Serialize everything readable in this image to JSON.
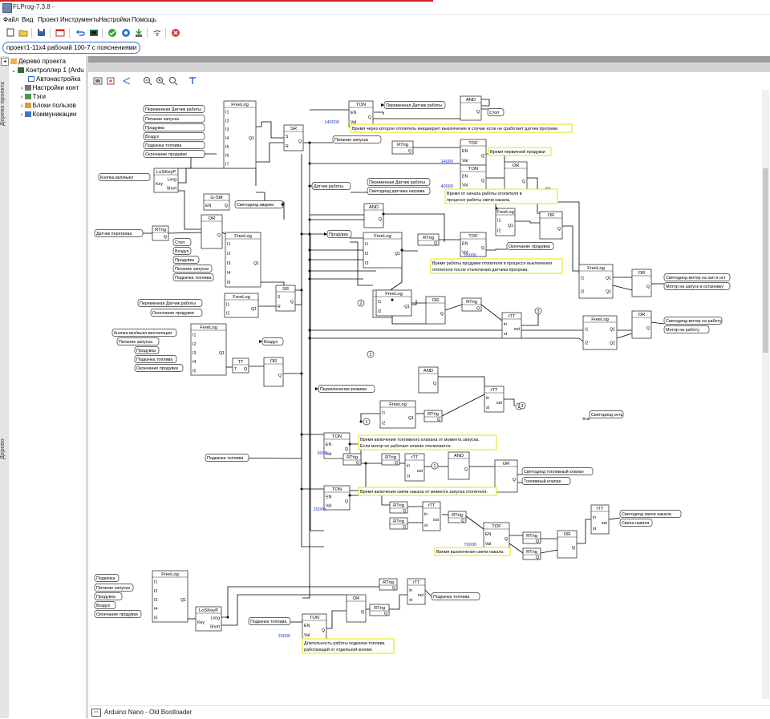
{
  "window": {
    "title": "FLProg-7.3.8 -"
  },
  "menu": {
    "items": [
      "Файл",
      "Вид",
      "Проект",
      "Инструменты",
      "Настройки",
      "Помощь"
    ]
  },
  "project_tab": {
    "label": "проект1-11х4 рабочий 100-7 с пояснениями"
  },
  "side_labels": {
    "project_tree": "Дерево проекта",
    "tree": "Дерево"
  },
  "tree": {
    "root": "Дерево проекта",
    "controller": "Контроллер 1 (Ardu",
    "items": [
      "Автонастройка",
      "Настройки конт",
      "Тэги",
      "Блоки пользов",
      "Коммуникации"
    ]
  },
  "statusbar": {
    "board": "Arduino Nano - Old Bootloader"
  },
  "colors": {
    "accent": "#3a6fd6",
    "note_border": "#e6e600",
    "const_text": "#1a3ad6",
    "wire": "#000000"
  },
  "diagram": {
    "blocks": [
      {
        "t": "FreeLog",
        "in": [
          "I1",
          "I2",
          "I3",
          "I4",
          "I5",
          "I6",
          "I7"
        ],
        "out": [
          "Q1"
        ]
      },
      {
        "t": "LoSKeyP",
        "in": [
          "Key"
        ],
        "out": [
          "Long",
          "Short"
        ]
      },
      {
        "t": "G-SM",
        "in": [
          "EN"
        ],
        "out": [
          "Q"
        ]
      },
      {
        "t": "RTrig",
        "in": [
          ""
        ],
        "out": [
          "Q"
        ]
      },
      {
        "t": "OR",
        "in": [
          "",
          ""
        ],
        "out": [
          "Q"
        ]
      },
      {
        "t": "FreeLog",
        "in": [
          "I1",
          "I2",
          "I3",
          "I4",
          "I5"
        ],
        "out": [
          "Q1"
        ]
      },
      {
        "t": "SR",
        "in": [
          "S",
          "R"
        ],
        "out": [
          "Q"
        ]
      },
      {
        "t": "FreeLog",
        "in": [
          "I1",
          "I2"
        ],
        "out": [
          "Q1"
        ]
      },
      {
        "t": "SR",
        "in": [
          "S",
          "R"
        ],
        "out": [
          "Q"
        ]
      },
      {
        "t": "FreeLog",
        "in": [
          "I1",
          "I2",
          "I3",
          "I4",
          "I5"
        ],
        "out": [
          "Q1"
        ]
      },
      {
        "t": "TT",
        "in": [
          "T"
        ],
        "out": [
          "Q"
        ]
      },
      {
        "t": "OR",
        "in": [
          "",
          ""
        ],
        "out": [
          "Q"
        ]
      },
      {
        "t": "TON",
        "in": [
          "EN",
          "Val"
        ],
        "out": [
          "Q"
        ]
      },
      {
        "t": "AND",
        "in": [
          "",
          ""
        ],
        "out": [
          "Q"
        ]
      },
      {
        "t": "RTrig",
        "in": [
          ""
        ],
        "out": [
          "Q"
        ]
      },
      {
        "t": "TOF",
        "in": [
          "EN",
          "Val"
        ],
        "out": [
          "Q"
        ]
      },
      {
        "t": "TON",
        "in": [
          "EN",
          "Val"
        ],
        "out": [
          "Q"
        ]
      },
      {
        "t": "OR",
        "in": [
          "",
          ""
        ],
        "out": [
          "Q"
        ]
      },
      {
        "t": "AND",
        "in": [
          "",
          ""
        ],
        "out": [
          "Q"
        ]
      },
      {
        "t": "OR",
        "in": [
          "",
          ""
        ],
        "out": [
          "Q"
        ]
      },
      {
        "t": "FreeLog",
        "in": [
          "I1",
          "I2",
          "I3"
        ],
        "out": [
          "Q1"
        ]
      },
      {
        "t": "RTrig",
        "in": [
          ""
        ],
        "out": [
          "Q"
        ]
      },
      {
        "t": "TOF",
        "in": [
          "EN",
          "Val"
        ],
        "out": [
          "Q"
        ]
      },
      {
        "t": "FreeLog",
        "in": [
          "I1",
          "I2"
        ],
        "out": [
          "Q1"
        ]
      },
      {
        "t": "OR",
        "in": [
          "",
          ""
        ],
        "out": [
          "Q"
        ]
      },
      {
        "t": "RTrig",
        "in": [
          ""
        ],
        "out": [
          "Q"
        ]
      },
      {
        "t": "rTT",
        "in": [
          "in",
          "st"
        ],
        "out": [
          "out"
        ]
      },
      {
        "t": "FreeLog",
        "in": [
          "I1",
          "I2"
        ],
        "out": [
          "Q1",
          "Q2"
        ]
      },
      {
        "t": "FreeLog",
        "in": [
          "I1",
          "I2"
        ],
        "out": [
          "Q1",
          "Q2"
        ]
      },
      {
        "t": "OR",
        "in": [
          "",
          ""
        ],
        "out": [
          "Q"
        ]
      },
      {
        "t": "OR",
        "in": [
          "",
          ""
        ],
        "out": [
          "Q"
        ]
      },
      {
        "t": "AND",
        "in": [
          "",
          ""
        ],
        "out": [
          "Q"
        ]
      },
      {
        "t": "FreeLog",
        "in": [
          "I1",
          "I2"
        ],
        "out": [
          "Q1"
        ]
      },
      {
        "t": "AND",
        "in": [
          "",
          ""
        ],
        "out": [
          "Q"
        ]
      },
      {
        "t": "rTT",
        "in": [
          "in",
          "st"
        ],
        "out": [
          "out"
        ]
      },
      {
        "t": "FreeLog",
        "in": [
          "I1",
          "I2"
        ],
        "out": [
          "Q1"
        ]
      },
      {
        "t": "RTrig",
        "in": [
          ""
        ],
        "out": [
          "Q"
        ]
      },
      {
        "t": "TON",
        "in": [
          "EN",
          "Val"
        ],
        "out": [
          "Q"
        ]
      },
      {
        "t": "RTrig",
        "in": [
          ""
        ],
        "out": [
          "Q"
        ]
      },
      {
        "t": "RTrig",
        "in": [
          ""
        ],
        "out": [
          "Q"
        ]
      },
      {
        "t": "rTT",
        "in": [
          "in",
          "st"
        ],
        "out": [
          "out"
        ]
      },
      {
        "t": "AND",
        "in": [
          "",
          ""
        ],
        "out": [
          "Q"
        ]
      },
      {
        "t": "OR",
        "in": [
          "",
          ""
        ],
        "out": [
          "Q"
        ]
      },
      {
        "t": "TON",
        "in": [
          "EN",
          "Val"
        ],
        "out": [
          "Q"
        ]
      },
      {
        "t": "RTrig",
        "in": [
          ""
        ],
        "out": [
          "Q"
        ]
      },
      {
        "t": "RTrig",
        "in": [
          ""
        ],
        "out": [
          "Q"
        ]
      },
      {
        "t": "rTT",
        "in": [
          "in",
          "st"
        ],
        "out": [
          "out"
        ]
      },
      {
        "t": "RTrig",
        "in": [
          ""
        ],
        "out": [
          "Q"
        ]
      },
      {
        "t": "TOF",
        "in": [
          "EN",
          "Val"
        ],
        "out": [
          "Q"
        ]
      },
      {
        "t": "RTrig",
        "in": [
          ""
        ],
        "out": [
          "Q"
        ]
      },
      {
        "t": "RTrig",
        "in": [
          ""
        ],
        "out": [
          "Q"
        ]
      },
      {
        "t": "OR",
        "in": [
          "",
          ""
        ],
        "out": [
          "Q"
        ]
      },
      {
        "t": "rTT",
        "in": [
          "in",
          "st"
        ],
        "out": [
          "out"
        ]
      },
      {
        "t": "FreeLog",
        "in": [
          "I1",
          "I2",
          "I3",
          "I4",
          "I5"
        ],
        "out": [
          "Q1"
        ]
      },
      {
        "t": "LoSKeyP",
        "in": [
          "Key"
        ],
        "out": [
          "Long",
          "Short"
        ]
      },
      {
        "t": "RTrig",
        "in": [
          ""
        ],
        "out": [
          "Q"
        ]
      },
      {
        "t": "rTT",
        "in": [
          "in",
          "st"
        ],
        "out": [
          "out"
        ]
      },
      {
        "t": "OR",
        "in": [
          "",
          ""
        ],
        "out": [
          "Q"
        ]
      },
      {
        "t": "RTrig",
        "in": [
          ""
        ],
        "out": [
          "Q"
        ]
      },
      {
        "t": "TON",
        "in": [
          "EN",
          "Val"
        ],
        "out": [
          "Q"
        ]
      }
    ],
    "tags": [
      "Переменная Датчик работы",
      "Питание запуска",
      "Продувка",
      "Воздух",
      "Подкачка топлива",
      "Окончание продувки",
      "Кнопка вкл/выкл",
      "Светодиод аварии",
      "Датчик перегрева",
      "Стоп",
      "Воздух",
      "Продувка",
      "Питание запуска",
      "Подкачка топлива",
      "Переменная Датчик работы",
      "Окончание продувки",
      "Кнопка вкл/выкл вентиляции",
      "Питание запуска",
      "Продувка",
      "Подкачка топлива",
      "Окончание продувки",
      "Воздух",
      "Переменная Датчик работы",
      "Стоп",
      "Питание запуска",
      "Датчик работы",
      "Переменная Датчик работы",
      "Светодиод датчика нагрева",
      "Продувка",
      "Окончание продувки",
      "Светодиод мотор на зап и ост",
      "Мотор на запуск и остановку",
      "Светодиод мотор на работу",
      "Мотор на работу",
      "Переключение режима",
      "Светодиод сеть",
      "Подкачка топлива",
      "Светодиод топливный клапан",
      "Топливный клапан",
      "Светодиод свечи накала",
      "Свеча накала",
      "Подкачка",
      "Питание запуска",
      "Продувка",
      "Воздух",
      "Окончание продувки",
      "Подкачка топлива",
      "Подкачка топлива"
    ],
    "consts": [
      "140000",
      "14000",
      "40000",
      "55000",
      "9000",
      "15000",
      "70000",
      "15000",
      "true"
    ],
    "refs": [
      "3",
      "3",
      "2",
      "2",
      "2",
      "1",
      "1",
      "3"
    ],
    "notes": [
      "Время через которое отопитель инициирует выключение в случае если не сработает датчик прогрева",
      "Время первичной продувки",
      "Время от начала работы отопителя в",
      "процессе работы свечи накала.",
      "Время работы продувки отопителя в процессе выключения",
      "отопителя после отключения датчика прогрева.",
      "Время включения топливного клапана от момента запуска.",
      "Если мотор не работает клапан отключается.",
      "Время включения свечи накала от момента запуска отопителя.",
      "Время выключения свечи накала.",
      "Длительность работы подкачки топлива",
      "работающей от отдельной кнопки."
    ]
  }
}
